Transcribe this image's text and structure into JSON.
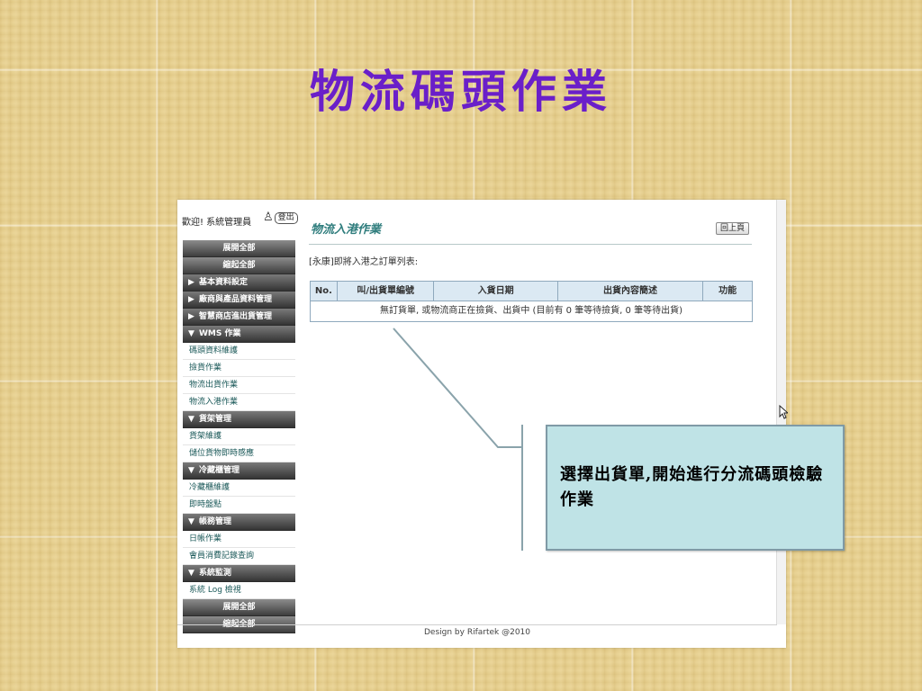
{
  "slide": {
    "title": "物流碼頭作業",
    "callout": "選擇出貨單,開始進行分流碼頭檢驗作業"
  },
  "header": {
    "welcome": "歡迎! 系統管理員",
    "logout_label": "登出"
  },
  "menu": {
    "expand_all": "展開全部",
    "collapse_all": "縮起全部",
    "sections": [
      {
        "label": "基本資料設定",
        "state": "collapsed",
        "items": []
      },
      {
        "label": "廠商與產品資料管理",
        "state": "collapsed",
        "items": []
      },
      {
        "label": "智慧商店進出貨管理",
        "state": "collapsed",
        "items": []
      },
      {
        "label": "WMS 作業",
        "state": "expanded",
        "items": [
          "碼頭資料維護",
          "撿貨作業",
          "物流出貨作業",
          "物流入港作業"
        ]
      },
      {
        "label": "貨架管理",
        "state": "expanded",
        "items": [
          "貨架維護",
          "儲位貨物即時感應"
        ]
      },
      {
        "label": "冷藏櫃管理",
        "state": "expanded",
        "items": [
          "冷藏櫃維護",
          "即時盤點"
        ]
      },
      {
        "label": "帳務管理",
        "state": "expanded",
        "items": [
          "日帳作業",
          "會員消費記錄查詢"
        ]
      },
      {
        "label": "系統監測",
        "state": "expanded",
        "items": [
          "系統 Log 檢視"
        ]
      }
    ],
    "expand_all_bottom": "展開全部",
    "collapse_all_bottom": "縮起全部"
  },
  "main": {
    "title": "物流入港作業",
    "back_label": "回上頁",
    "listing_label": "[永康]即將入港之訂單列表:",
    "table": {
      "headers": [
        "No.",
        "叫/出貨單編號",
        "入貨日期",
        "出貨內容簡述",
        "功能"
      ],
      "empty_message": "無訂貨單, 或物流商正在撿貨、出貨中 (目前有 0 筆等待撿貨, 0 筆等待出貨)"
    }
  },
  "footer": {
    "text": "Design by Rifartek @2010"
  },
  "icons": {
    "logout": "person-door-icon",
    "cursor": "mouse-pointer-icon",
    "triangle_collapsed": "▶",
    "triangle_expanded": "▼"
  },
  "colors": {
    "title": "#6a1fc9",
    "page_title": "#2f7d7d",
    "callout_bg": "#bfe3e6",
    "table_header_bg": "#dbe9f3"
  }
}
